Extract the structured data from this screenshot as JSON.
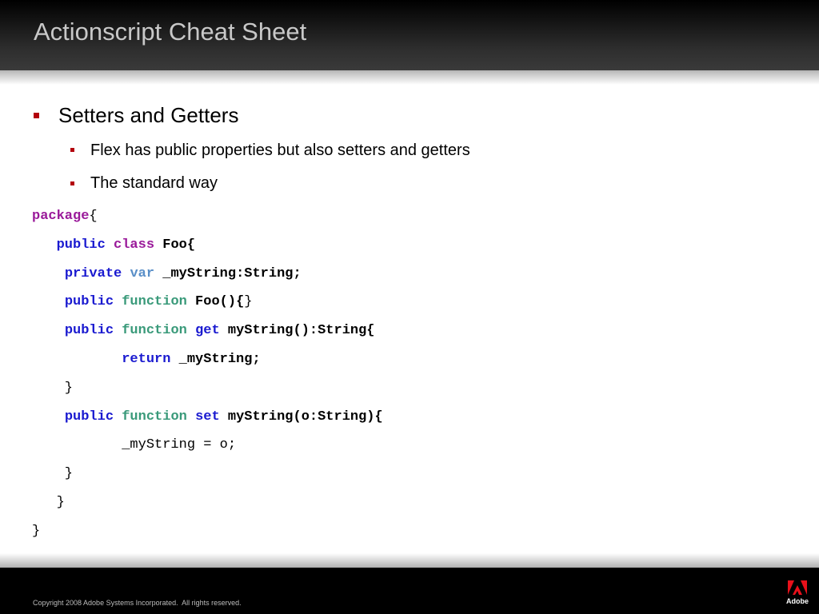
{
  "slide": {
    "title": "Actionscript Cheat Sheet"
  },
  "bullets": [
    {
      "level": 1,
      "text": "Setters and Getters"
    },
    {
      "level": 2,
      "text": "Flex has public properties but also setters and getters"
    },
    {
      "level": 2,
      "text": "The standard way"
    }
  ],
  "code": {
    "lines": [
      [
        {
          "t": "package",
          "c": "#9a1a9a",
          "k": true
        },
        {
          "t": "{",
          "c": "#000000"
        }
      ],
      [
        {
          "t": "   ",
          "c": "#000000"
        },
        {
          "t": "public",
          "c": "#1a1ad0",
          "k": true
        },
        {
          "t": " ",
          "c": "#000000"
        },
        {
          "t": "class",
          "c": "#9a1a9a",
          "k": true
        },
        {
          "t": " Foo{",
          "c": "#000000",
          "k": true
        }
      ],
      [
        {
          "t": "    ",
          "c": "#000000"
        },
        {
          "t": "private",
          "c": "#1a1ad0",
          "k": true
        },
        {
          "t": " ",
          "c": "#000000"
        },
        {
          "t": "var",
          "c": "#5a8fc8",
          "k": true
        },
        {
          "t": " _myString:String;",
          "c": "#000000",
          "k": true
        }
      ],
      [
        {
          "t": "    ",
          "c": "#000000"
        },
        {
          "t": "public",
          "c": "#1a1ad0",
          "k": true
        },
        {
          "t": " ",
          "c": "#000000"
        },
        {
          "t": "function",
          "c": "#3a9a7a",
          "k": true
        },
        {
          "t": " Foo(){",
          "c": "#000000",
          "k": true
        },
        {
          "t": "}",
          "c": "#000000"
        }
      ],
      [
        {
          "t": "    ",
          "c": "#000000"
        },
        {
          "t": "public",
          "c": "#1a1ad0",
          "k": true
        },
        {
          "t": " ",
          "c": "#000000"
        },
        {
          "t": "function",
          "c": "#3a9a7a",
          "k": true
        },
        {
          "t": " ",
          "c": "#000000"
        },
        {
          "t": "get",
          "c": "#1a1ad0",
          "k": true
        },
        {
          "t": " myString():String{",
          "c": "#000000",
          "k": true
        }
      ],
      [
        {
          "t": "           ",
          "c": "#000000"
        },
        {
          "t": "return",
          "c": "#1a1ad0",
          "k": true
        },
        {
          "t": " _myString;",
          "c": "#000000",
          "k": true
        }
      ],
      [
        {
          "t": "    }",
          "c": "#000000"
        }
      ],
      [
        {
          "t": "    ",
          "c": "#000000"
        },
        {
          "t": "public",
          "c": "#1a1ad0",
          "k": true
        },
        {
          "t": " ",
          "c": "#000000"
        },
        {
          "t": "function",
          "c": "#3a9a7a",
          "k": true
        },
        {
          "t": " ",
          "c": "#000000"
        },
        {
          "t": "set",
          "c": "#1a1ad0",
          "k": true
        },
        {
          "t": " myString(o:String){",
          "c": "#000000",
          "k": true
        }
      ],
      [
        {
          "t": "           _myString = o;",
          "c": "#000000"
        }
      ],
      [
        {
          "t": "    }",
          "c": "#000000"
        }
      ],
      [
        {
          "t": "   }",
          "c": "#000000"
        }
      ],
      [
        {
          "t": "}",
          "c": "#000000"
        }
      ]
    ]
  },
  "footer": {
    "copyright": "Copyright 2008 Adobe Systems Incorporated.  All rights reserved.",
    "logo_text": "Adobe"
  },
  "colors": {
    "accent_red": "#b3000c",
    "title_gray": "#c8c8c8"
  }
}
